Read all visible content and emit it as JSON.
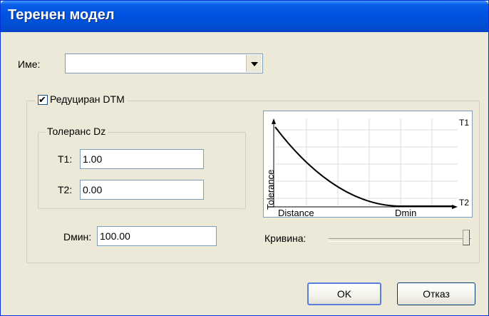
{
  "window": {
    "title": "Теренен модел"
  },
  "name_field": {
    "label": "Име:",
    "value": ""
  },
  "reduced_dtm": {
    "label": "Редуциран DTM",
    "checked": true
  },
  "tolerance": {
    "group_label": "Толеранс Dz",
    "t1_label": "T1:",
    "t1_value": "1.00",
    "t2_label": "T2:",
    "t2_value": "0.00"
  },
  "dmin": {
    "label": "Dмин:",
    "value": "100.00"
  },
  "graph": {
    "y_label": "Tolerance",
    "x_label": "Distance",
    "dmin_label": "Dmin",
    "t1_label": "T1",
    "t2_label": "T2"
  },
  "curve": {
    "label": "Кривина:",
    "value_fraction": 1.0
  },
  "buttons": {
    "ok": "OK",
    "cancel": "Отказ"
  }
}
